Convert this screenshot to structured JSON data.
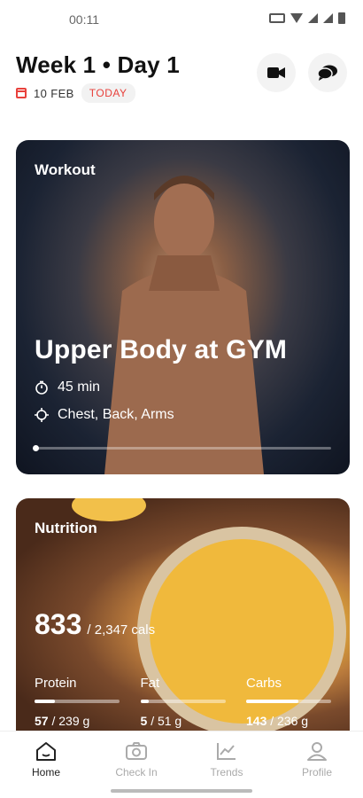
{
  "status_bar": {
    "time": "00:11"
  },
  "header": {
    "title": "Week 1 • Day 1",
    "date": "10 FEB",
    "today_badge": "TODAY"
  },
  "workout": {
    "label": "Workout",
    "title": "Upper Body at GYM",
    "duration": "45 min",
    "muscles": "Chest, Back, Arms",
    "progress": 0
  },
  "nutrition": {
    "label": "Nutrition",
    "calories_eaten": "833",
    "calories_target": "/ 2,347 cals",
    "macros": [
      {
        "name": "Protein",
        "value": "57",
        "target": "/ 239 g",
        "fraction": 0.24
      },
      {
        "name": "Fat",
        "value": "5",
        "target": "/ 51 g",
        "fraction": 0.1
      },
      {
        "name": "Carbs",
        "value": "143",
        "target": "/ 236 g",
        "fraction": 0.61
      }
    ]
  },
  "nav": {
    "items": [
      {
        "label": "Home",
        "icon": "home-icon",
        "active": true
      },
      {
        "label": "Check In",
        "icon": "camera-icon",
        "active": false
      },
      {
        "label": "Trends",
        "icon": "chart-icon",
        "active": false
      },
      {
        "label": "Profile",
        "icon": "user-icon",
        "active": false
      }
    ]
  },
  "colors": {
    "accent": "#e8413c"
  }
}
